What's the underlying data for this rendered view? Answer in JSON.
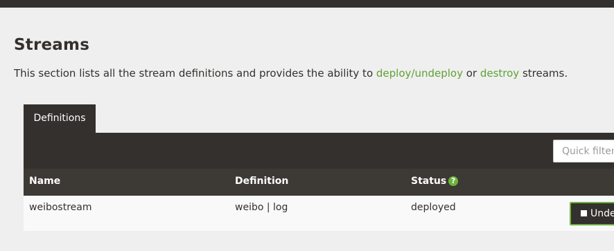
{
  "header": {
    "bar": ""
  },
  "page": {
    "title": "Streams",
    "intro": {
      "text_before": "This section lists all the stream definitions and provides the ability to ",
      "link1": "deploy/undeploy",
      "text_middle": " or ",
      "link2": "destroy",
      "text_after": " streams."
    }
  },
  "tabs": [
    {
      "label": "Definitions",
      "active": true
    }
  ],
  "filter": {
    "placeholder": "Quick filter",
    "value": ""
  },
  "table": {
    "columns": [
      {
        "label": "Name"
      },
      {
        "label": "Definition"
      },
      {
        "label": "Status",
        "help_icon": "question-circle-icon"
      }
    ],
    "rows": [
      {
        "name": "weibostream",
        "definition": "weibo | log",
        "status": "deployed",
        "action_label": "Undeploy"
      }
    ]
  },
  "colors": {
    "dark": "#34302d",
    "header": "#3d3934",
    "accent": "#6db33f",
    "link": "#5fa134",
    "background": "#efefef"
  }
}
